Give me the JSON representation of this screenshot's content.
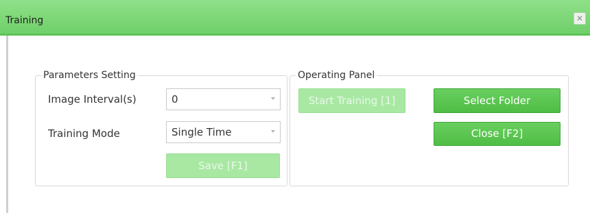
{
  "window": {
    "title": "Training",
    "close_glyph": "✕"
  },
  "parameters": {
    "legend": "Parameters Setting",
    "image_interval_label": "Image Interval(s)",
    "image_interval_value": "0",
    "training_mode_label": "Training Mode",
    "training_mode_value": "Single Time",
    "save_label": "Save [F1]"
  },
  "operating": {
    "legend": "Operating Panel",
    "start_label": "Start Training [1]",
    "select_folder_label": "Select Folder",
    "close_label": "Close [F2]"
  },
  "colors": {
    "titlebar": "#7fd878",
    "button_active": "#5ac650",
    "button_disabled": "#a8e8a3"
  }
}
